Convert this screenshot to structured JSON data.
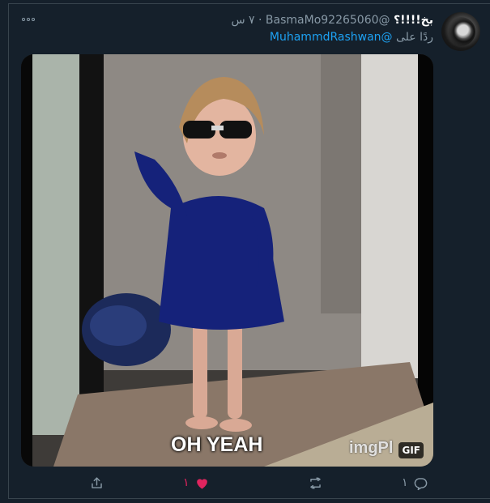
{
  "tweet": {
    "display_name": "بخ!!!!؟",
    "handle": "@BasmaMo92265060",
    "separator": "·",
    "time": "٧ س",
    "reply_prefix": "ردًا على",
    "reply_mention": "@MuhammdRashwan",
    "more_icon": "more-icon",
    "avatar_icon": "avatar"
  },
  "media": {
    "type": "gif",
    "caption_overlay": "OH YEAH",
    "watermark": "imgPl",
    "badge": "GIF"
  },
  "actions": {
    "reply": {
      "icon": "reply-icon",
      "count": "١"
    },
    "retweet": {
      "icon": "retweet-icon",
      "count": ""
    },
    "like": {
      "icon": "heart-icon",
      "count": "١",
      "color": "#e0245e"
    },
    "share": {
      "icon": "share-icon",
      "count": ""
    }
  },
  "colors": {
    "background": "#15202b",
    "border": "#38444d",
    "muted_text": "#8899a6",
    "link": "#1da1f2",
    "like": "#e0245e"
  }
}
